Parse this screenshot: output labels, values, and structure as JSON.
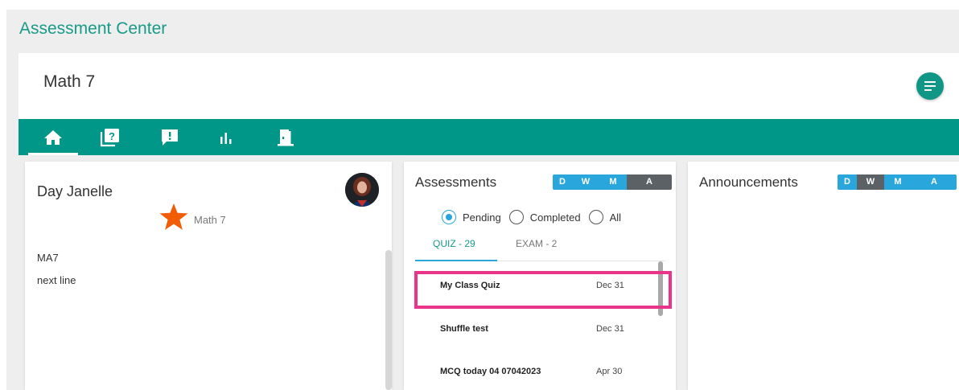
{
  "app": {
    "title": "Assessment Center"
  },
  "course": {
    "title": "Math 7"
  },
  "nav": {
    "items": [
      {
        "name": "home",
        "icon": "home-icon"
      },
      {
        "name": "assessments",
        "icon": "question-book-icon"
      },
      {
        "name": "announcements",
        "icon": "exclamation-chat-icon"
      },
      {
        "name": "reports",
        "icon": "bar-chart-icon"
      },
      {
        "name": "exit",
        "icon": "exit-door-icon"
      }
    ],
    "active": "home"
  },
  "profile": {
    "name": "Day Janelle",
    "course_label": "Math 7",
    "code": "MA7",
    "note": "next line"
  },
  "assessments": {
    "title": "Assessments",
    "filters": [
      "D",
      "W",
      "M",
      "A"
    ],
    "selected_filter": "A",
    "radios": [
      {
        "label": "Pending",
        "checked": true
      },
      {
        "label": "Completed",
        "checked": false
      },
      {
        "label": "All",
        "checked": false
      }
    ],
    "tabs": [
      {
        "label": "QUIZ - 29",
        "active": true
      },
      {
        "label": "EXAM - 2",
        "active": false
      }
    ],
    "items": [
      {
        "name": "My Class Quiz",
        "date": "Dec 31"
      },
      {
        "name": "Shuffle test",
        "date": "Dec 31"
      },
      {
        "name": "MCQ today 04 07042023",
        "date": "Apr 30"
      }
    ]
  },
  "announcements": {
    "title": "Announcements",
    "filters": [
      "D",
      "W",
      "M",
      "A"
    ],
    "selected_filter": "W"
  },
  "colors": {
    "brand": "#009688",
    "accent": "#29a6dc",
    "highlight": "#e8358a",
    "star": "#f25c05"
  }
}
